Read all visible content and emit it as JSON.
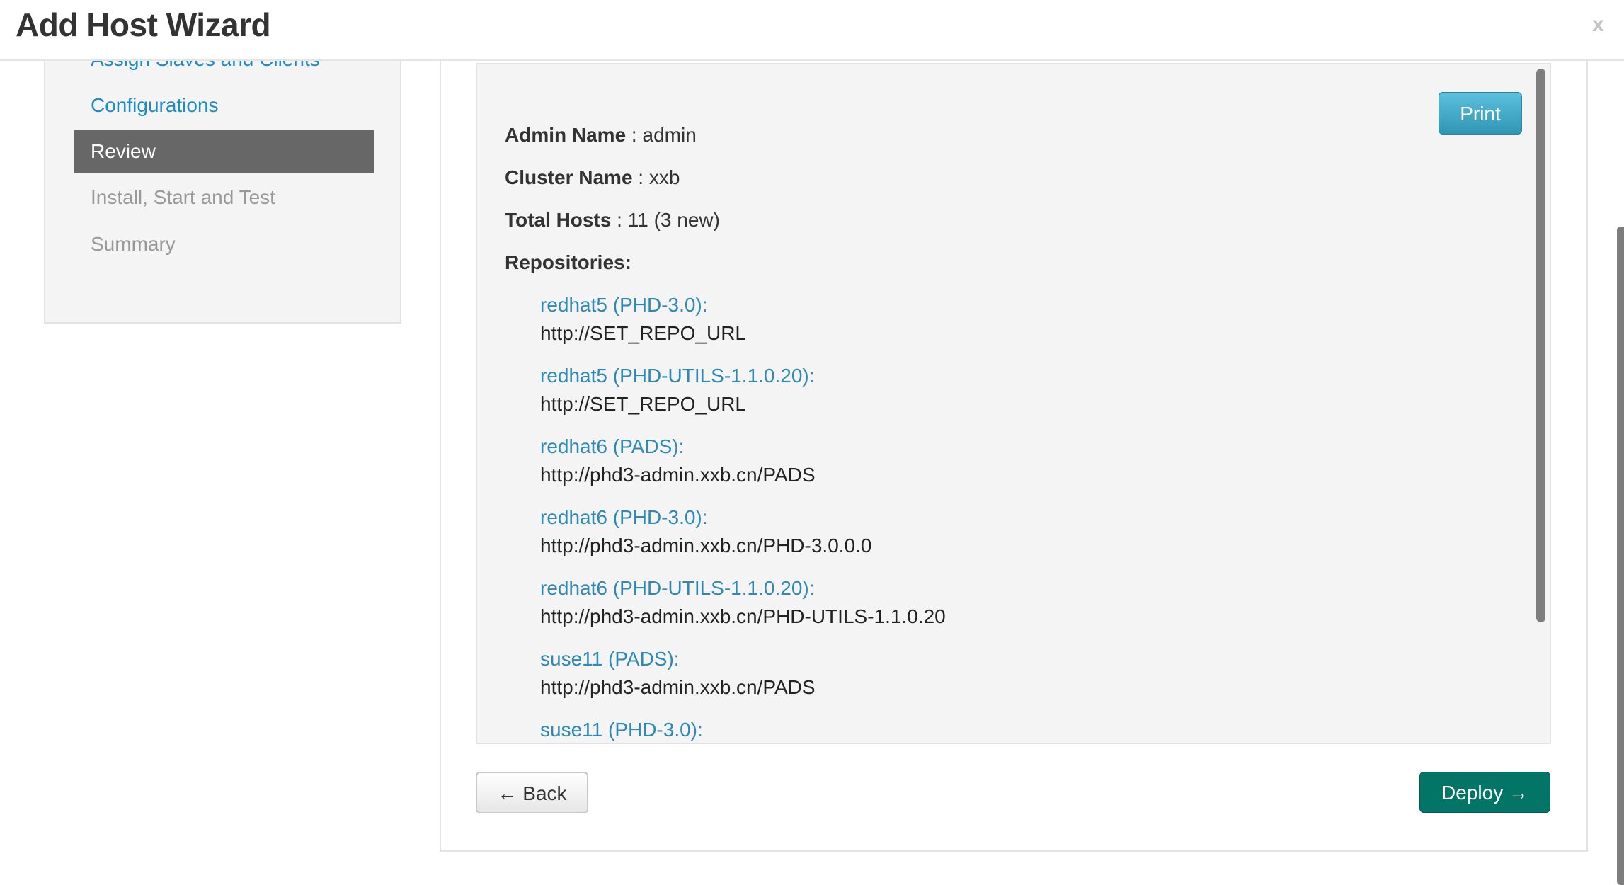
{
  "header": {
    "title": "Add Host Wizard",
    "close_label": "x"
  },
  "sidebar": {
    "items": [
      {
        "label": "Assign Slaves and Clients",
        "state": "done"
      },
      {
        "label": "Configurations",
        "state": "done"
      },
      {
        "label": "Review",
        "state": "active"
      },
      {
        "label": "Install, Start and Test",
        "state": "todo"
      },
      {
        "label": "Summary",
        "state": "todo"
      }
    ]
  },
  "review": {
    "print_label": "Print",
    "admin": {
      "label": "Admin Name",
      "sep": " : ",
      "value": "admin"
    },
    "cluster": {
      "label": "Cluster Name",
      "sep": " : ",
      "value": "xxb"
    },
    "hosts": {
      "label": "Total Hosts",
      "sep": " : ",
      "value": "11 (3 new)"
    },
    "repositories_label": "Repositories:",
    "repositories": [
      {
        "name": "redhat5 (PHD-3.0):",
        "url": "http://SET_REPO_URL"
      },
      {
        "name": "redhat5 (PHD-UTILS-1.1.0.20):",
        "url": "http://SET_REPO_URL"
      },
      {
        "name": "redhat6 (PADS):",
        "url": "http://phd3-admin.xxb.cn/PADS"
      },
      {
        "name": "redhat6 (PHD-3.0):",
        "url": "http://phd3-admin.xxb.cn/PHD-3.0.0.0"
      },
      {
        "name": "redhat6 (PHD-UTILS-1.1.0.20):",
        "url": "http://phd3-admin.xxb.cn/PHD-UTILS-1.1.0.20"
      },
      {
        "name": "suse11 (PADS):",
        "url": "http://phd3-admin.xxb.cn/PADS"
      },
      {
        "name": "suse11 (PHD-3.0):",
        "url": ""
      }
    ]
  },
  "footer": {
    "back_label": "← Back",
    "deploy_label": "Deploy →"
  },
  "colors": {
    "link": "#2f89b5",
    "nav_done": "#1b8dc6",
    "nav_active_bg": "#676767",
    "print_btn": "#49afcd",
    "deploy_btn": "#037566"
  }
}
